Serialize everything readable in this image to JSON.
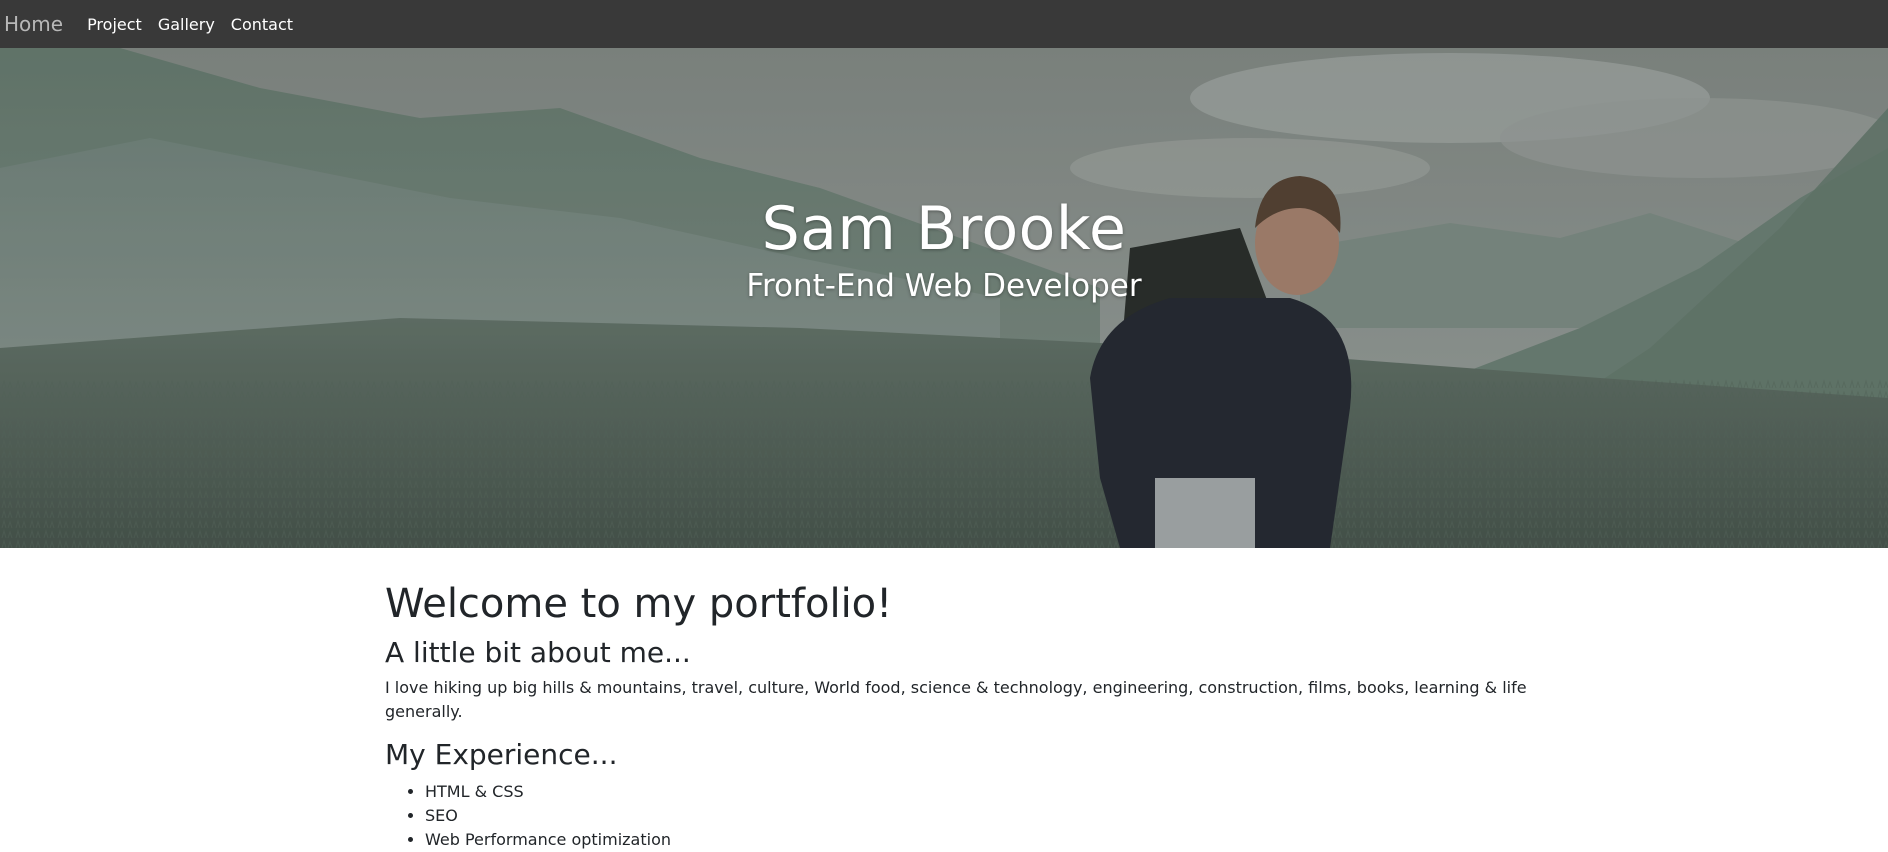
{
  "nav": {
    "brand": "Home",
    "links": [
      "Project",
      "Gallery",
      "Contact"
    ]
  },
  "hero": {
    "title": "Sam Brooke",
    "subtitle": "Front-End Web Developer"
  },
  "main": {
    "welcome": "Welcome to my portfolio!",
    "about_heading": "A little bit about me...",
    "about_text": "I love hiking up big hills & mountains, travel, culture, World food, science & technology, engineering, construction, films, books, learning & life generally.",
    "experience_heading": "My Experience...",
    "experience_items": [
      "HTML & CSS",
      "SEO",
      "Web Performance optimization"
    ]
  },
  "colors": {
    "navbar": "#393939",
    "brand": "#b8b8b8",
    "nav_link": "#ffffff",
    "body_text": "#212529",
    "hero_tint": "#6f8a7c"
  }
}
